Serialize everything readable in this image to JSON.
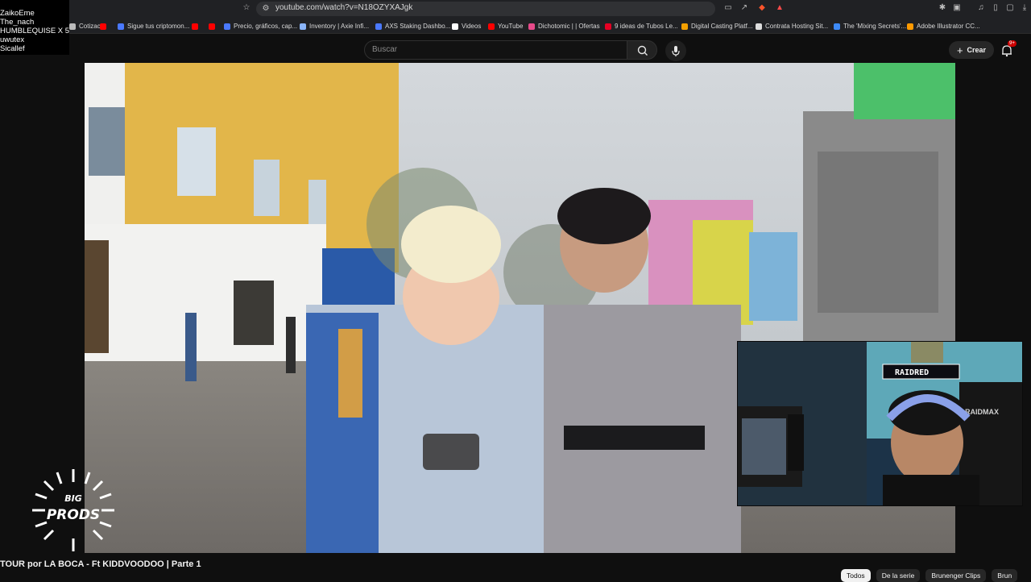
{
  "browser": {
    "url": "youtube.com/watch?v=N18OZYXAJgk",
    "bookmarks": [
      {
        "label": "Cotizac...",
        "color": "#bbbbbb"
      },
      {
        "label": "",
        "color": "#ff0000"
      },
      {
        "label": "Sigue tus criptomon...",
        "color": "#4a79ff"
      },
      {
        "label": "",
        "color": "#ff0000"
      },
      {
        "label": "",
        "color": "#ff0000"
      },
      {
        "label": "Precio, gráficos, cap...",
        "color": "#4a79ff"
      },
      {
        "label": "Inventory | Axie Infi...",
        "color": "#8ab4f8"
      },
      {
        "label": "AXS Staking Dashbo...",
        "color": "#4a79ff"
      },
      {
        "label": "Videos",
        "color": "#ffffff"
      },
      {
        "label": "YouTube",
        "color": "#ff0000"
      },
      {
        "label": "Dichotomic | | Ofertas",
        "color": "#e84a8a"
      },
      {
        "label": "9 ideas de Tubos Le...",
        "color": "#e60023"
      },
      {
        "label": "Digital Casting Platf...",
        "color": "#f4a000"
      },
      {
        "label": "Contrata Hosting Sit...",
        "color": "#dddddd"
      },
      {
        "label": "The 'Mixing Secrets'...",
        "color": "#3d8af7"
      },
      {
        "label": "Adobe Illustrator CC...",
        "color": "#ff9a00"
      }
    ]
  },
  "overlay": {
    "viewers": [
      "ZaikoEme",
      "The_nach",
      "HUMBLEQUISE X 5",
      "uwutex",
      "Sicallef"
    ]
  },
  "header": {
    "search_placeholder": "Buscar",
    "create_label": "Crear",
    "notif_count": "9+"
  },
  "webcam": {
    "sign_text": "RAIDRED",
    "chair_brand": "RAIDMAX"
  },
  "logo": {
    "text_top": "BIG",
    "text_bottom": "PRODS"
  },
  "video": {
    "title": "TOUR por LA BOCA - Ft KIDDVOODOO | Parte 1"
  },
  "chips": [
    "Todos",
    "De la serie",
    "Brunenger Clips",
    "Brun"
  ],
  "colors": {
    "youtube_red": "#ff0000",
    "accent": "#3ea6ff"
  }
}
